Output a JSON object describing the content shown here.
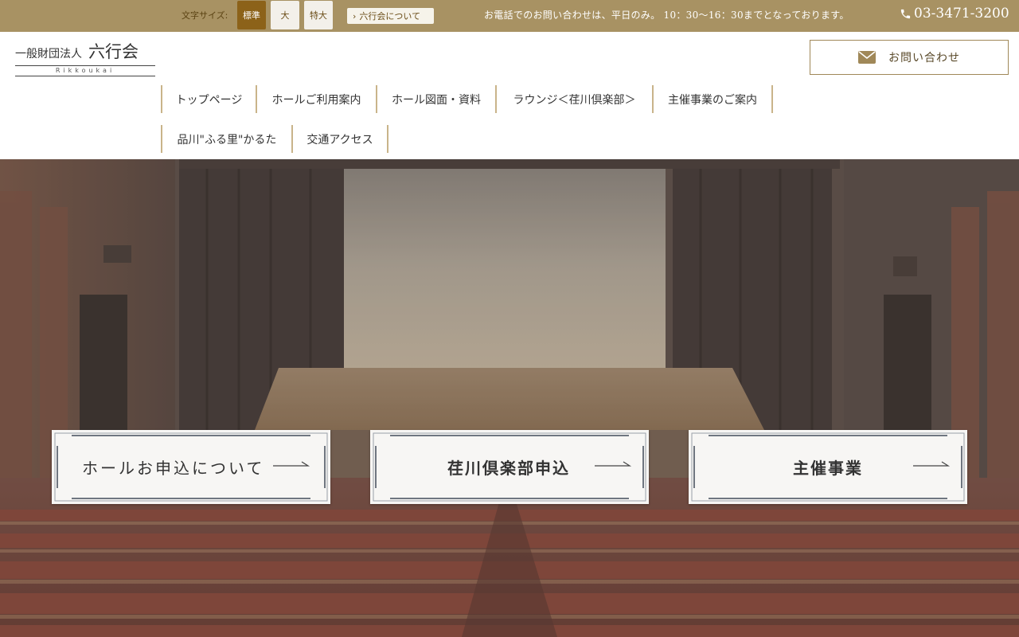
{
  "topbar": {
    "font_size_label": "文字サイズ:",
    "font_size_options": [
      "標準",
      "大",
      "特大"
    ],
    "about_link": "六行会について",
    "notice": "お電話でのお問い合わせは、平日のみ。 10：30～16：30までとなっております。",
    "phone": "03-3471-3200"
  },
  "logo": {
    "subtitle": "一般財団法人",
    "name": "六行会",
    "romaji": "Rikkoukai"
  },
  "contact_button": "お問い合わせ",
  "nav": [
    "トップページ",
    "ホールご利用案内",
    "ホール図面・資料",
    "ラウンジ＜荏川倶楽部＞",
    "主催事業のご案内",
    "品川\"ふる里\"かるた",
    "交通アクセス"
  ],
  "hero": {
    "cta": [
      "ホールお申込について",
      "荏川倶楽部申込",
      "主催事業"
    ]
  },
  "colors": {
    "topbar": "#a89263",
    "accent": "#8c6219",
    "nav_divider": "#c9b48a",
    "seat": "#8a4a3e"
  }
}
